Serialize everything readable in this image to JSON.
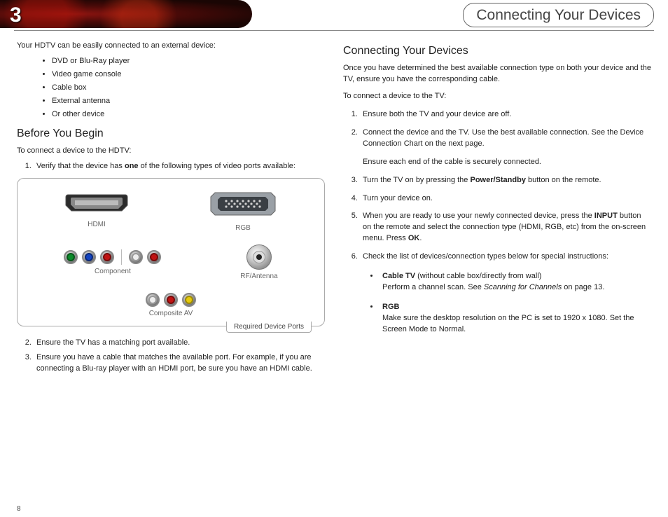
{
  "chapter_number": "3",
  "header_title": "Connecting Your Devices",
  "page_number": "8",
  "left": {
    "intro": "Your HDTV can be easily connected to an external device:",
    "devices": [
      "DVD or Blu-Ray player",
      "Video game console",
      "Cable box",
      "External antenna",
      "Or other device"
    ],
    "before_heading": "Before You Begin",
    "before_intro": "To connect a device to the HDTV:",
    "step1_pre": "Verify that the device has ",
    "step1_bold": "one",
    "step1_post": " of the following types of video ports available:",
    "step2": "Ensure the TV has a matching port available.",
    "step3": "Ensure you have a cable that matches the available port. For example, if you are connecting a Blu-ray player with an HDMI port, be sure you have an HDMI cable.",
    "ports": {
      "hdmi": "HDMI",
      "rgb": "RGB",
      "component": "Component",
      "rf": "RF/Antenna",
      "composite": "Composite AV",
      "caption": "Required Device Ports"
    }
  },
  "right": {
    "heading": "Connecting Your Devices",
    "para1": "Once you have determined the best available connection type on both your device and the TV, ensure you have the corresponding cable.",
    "para2": "To connect a device to the TV:",
    "s1": "Ensure both the TV and your device are off.",
    "s2a": "Connect the device and the TV. Use the best available connection. See the Device Connection Chart on the next page.",
    "s2b": "Ensure each end of the cable is securely connected.",
    "s3_pre": "Turn the TV on by pressing the ",
    "s3_bold": "Power/Standby",
    "s3_post": " button on the remote.",
    "s4": "Turn your device on.",
    "s5_pre": "When you are ready to use your newly connected device, press the ",
    "s5_bold": "INPUT",
    "s5_mid": " button on the remote and select the connection type (HDMI, RGB, etc) from the on-screen menu. Press ",
    "s5_bold2": "OK",
    "s5_post": ".",
    "s6": "Check the list of devices/connection types below for special instructions:",
    "cable_label": "Cable TV",
    "cable_paren": " (without cable box/directly from wall)",
    "cable_body_pre": "Perform a channel scan. See ",
    "cable_body_em": "Scanning for Channels",
    "cable_body_post": " on page 13.",
    "rgb_label": "RGB",
    "rgb_body": "Make sure the desktop resolution on the PC is set to 1920 x 1080. Set the Screen Mode to Normal."
  }
}
